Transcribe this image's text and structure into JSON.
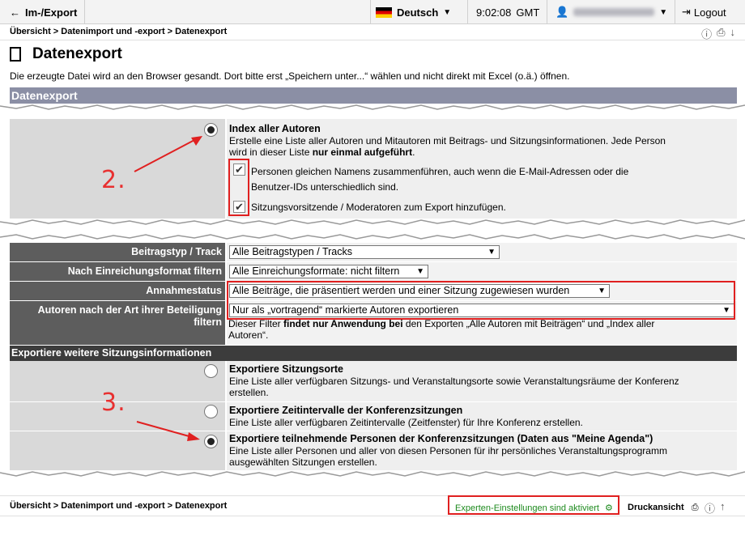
{
  "topbar": {
    "back_label": "Im-/Export",
    "language": "Deutsch",
    "time": "9:02:08",
    "timezone": "GMT",
    "logout_label": "Logout"
  },
  "breadcrumb": "Übersicht > Datenimport und -export > Datenexport",
  "page": {
    "title": "Datenexport",
    "intro": "Die erzeugte Datei wird an den Browser gesandt. Dort bitte erst „Speichern unter...“ wählen und nicht direkt mit Excel (o.ä.) öffnen.",
    "section_title": "Datenexport"
  },
  "index_option": {
    "title": "Index aller Autoren",
    "desc_line1": "Erstelle eine Liste aller Autoren und Mitautoren mit Beitrags- und Sitzungsinformationen. Jede Person",
    "desc_line2_pre": "wird in dieser Liste ",
    "desc_line2_bold": "nur einmal aufgeführt",
    "desc_line2_post": ".",
    "check1_line1": "Personen gleichen Namens zusammenführen, auch wenn die E-Mail-Adressen oder die",
    "check1_line2": "Benutzer-IDs unterschiedlich sind.",
    "check2": "Sitzungsvorsitzende / Moderatoren zum Export hinzufügen."
  },
  "filters": [
    {
      "label": "Beitragstyp / Track",
      "value": "Alle Beitragstypen / Tracks"
    },
    {
      "label": "Nach Einreichungsformat filtern",
      "value": "Alle Einreichungsformate: nicht filtern"
    },
    {
      "label": "Annahmestatus",
      "value": "Alle Beiträge, die präsentiert werden und einer Sitzung zugewiesen wurden"
    },
    {
      "label_line1": "Autoren nach der Art ihrer Beteiligung",
      "label_line2": "filtern",
      "value": "Nur als „vortragend“ markierte Autoren exportieren"
    }
  ],
  "filter_note": {
    "pre": "Dieser Filter ",
    "bold": "findet nur Anwendung bei",
    "post": " den Exporten „Alle Autoren mit Beiträgen“ und „Index aller",
    "line2": "Autoren“."
  },
  "session_section_title": "Exportiere weitere Sitzungsinformationen",
  "session_options": [
    {
      "title": "Exportiere Sitzungsorte",
      "desc_line1": "Eine Liste aller verfügbaren Sitzungs- und Veranstaltungsorte sowie Veranstaltungsräume der Konferenz",
      "desc_line2": "erstellen."
    },
    {
      "title": "Exportiere Zeitintervalle der Konferenzsitzungen",
      "desc_line1": "Eine Liste aller verfügbaren Zeitintervalle (Zeitfenster) für Ihre Konferenz erstellen.",
      "desc_line2": ""
    },
    {
      "title": "Exportiere teilnehmende Personen der Konferenzsitzungen (Daten aus \"Meine Agenda\")",
      "desc_line1": "Eine Liste aller Personen und aller von diesen Personen für ihr persönliches Veranstaltungsprogramm",
      "desc_line2": "ausgewählten Sitzungen erstellen."
    }
  ],
  "annotations": {
    "step2": "2.",
    "step3": "3."
  },
  "footer": {
    "breadcrumb": "Übersicht > Datenimport und -export > Datenexport",
    "expert_label": "Experten-Einstellungen sind aktiviert",
    "print_label": "Druckansicht"
  },
  "colors": {
    "accent_red": "#e02020",
    "section_bg": "#8b8fa5",
    "label_bg": "#5d5d5d",
    "expert_green": "#1d8a1d"
  }
}
